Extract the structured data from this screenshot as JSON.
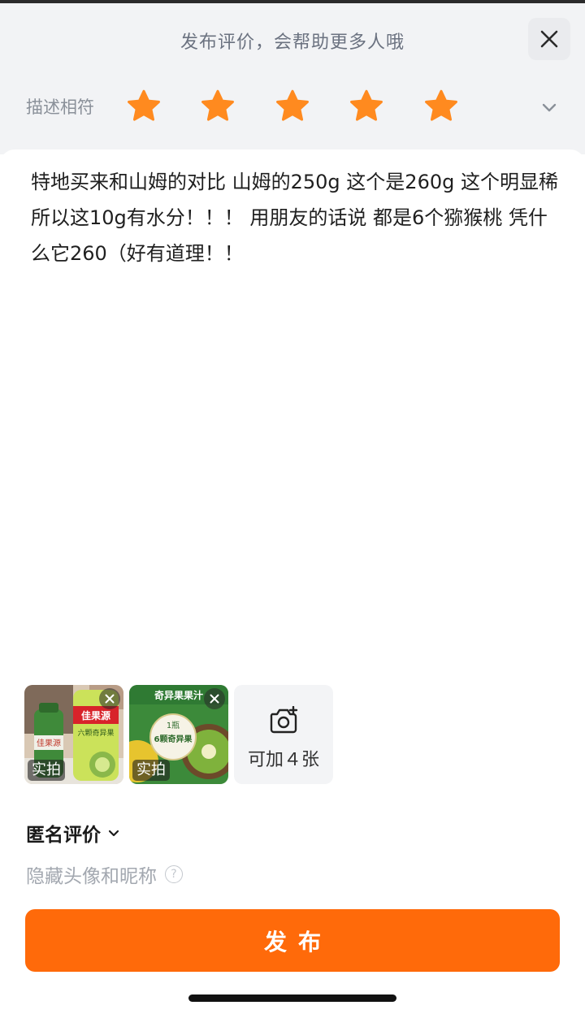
{
  "header": {
    "title": "发布评价，会帮助更多人哦",
    "close_icon": "close-icon"
  },
  "rating": {
    "label": "描述相符",
    "value": 5,
    "max": 5,
    "star_color": "#ff8a1f",
    "expand_icon": "chevron-down-icon"
  },
  "review": {
    "text": "特地买来和山姆的对比 山姆的250g 这个是260g 这个明显稀 所以这10g有水分！！！ 用朋友的话说 都是6个猕猴桃 凭什么它260（好有道理！！"
  },
  "photos": {
    "items": [
      {
        "tag": "实拍",
        "remove_icon": "close-icon"
      },
      {
        "tag": "实拍",
        "remove_icon": "close-icon"
      }
    ],
    "photo_1_texts": [
      "佳果源",
      "六颗奇异果",
      "佳果源"
    ],
    "photo_2_texts": [
      "奇异果果汁",
      "1瓶",
      "6颗奇异果"
    ],
    "add_label": "可加４张",
    "add_icon": "camera-plus-icon"
  },
  "anonymous": {
    "label": "匿名评价",
    "chevron_icon": "chevron-down-icon",
    "hint": "隐藏头像和昵称",
    "help_icon": "question-circle-icon",
    "help_glyph": "?"
  },
  "footer": {
    "publish_label": "发布"
  },
  "colors": {
    "accent": "#ff6a0a",
    "header_bg": "#f2f3f5",
    "muted_text": "#a3a8b0"
  }
}
